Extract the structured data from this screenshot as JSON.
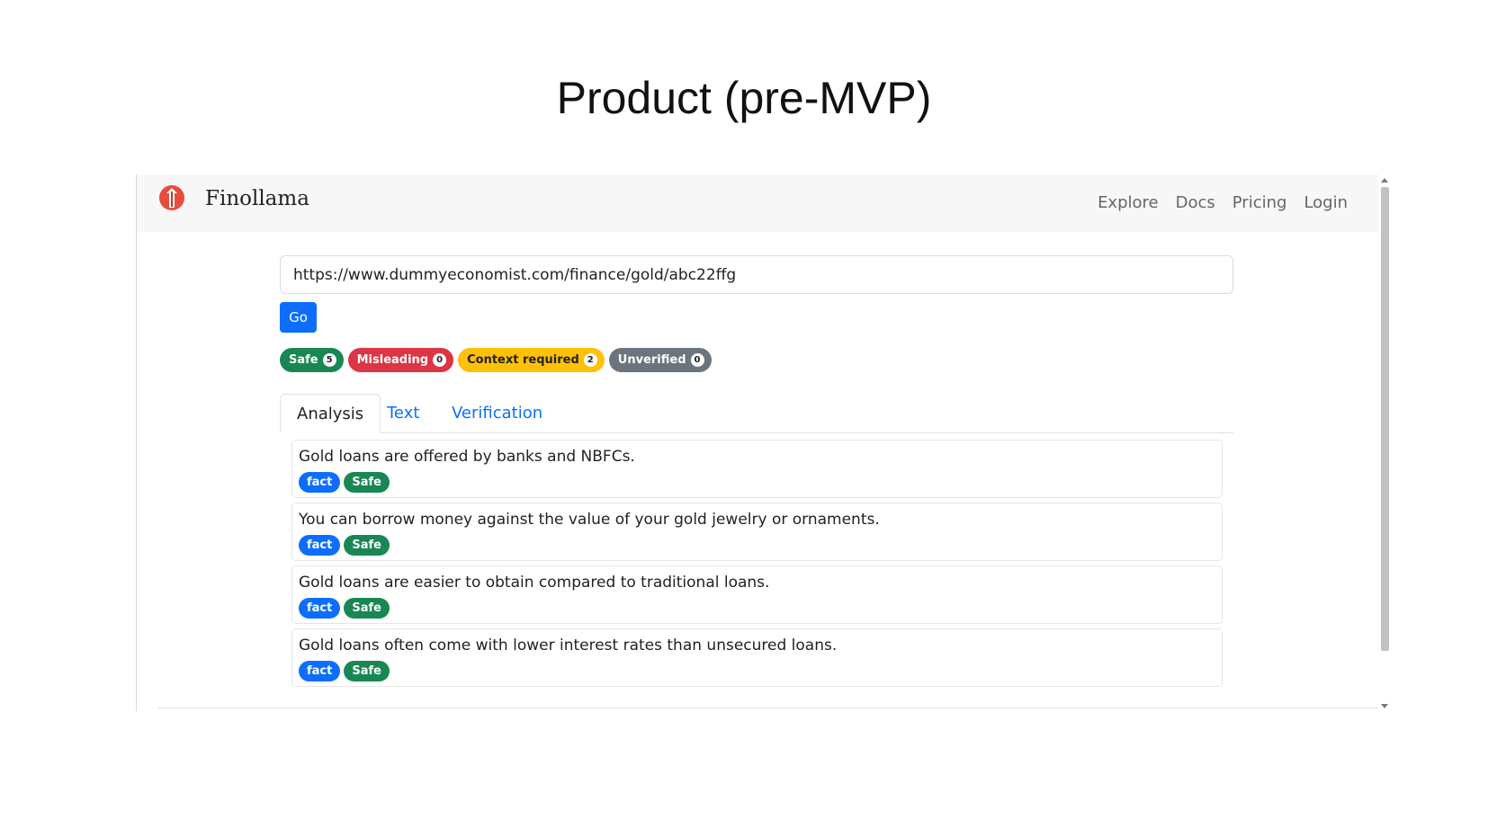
{
  "slide": {
    "title": "Product (pre-MVP)"
  },
  "app": {
    "brand": "Finollama",
    "logo_icon": "finollama-logo-icon"
  },
  "nav": {
    "items": [
      "Explore",
      "Docs",
      "Pricing",
      "Login"
    ]
  },
  "search": {
    "value": "https://www.dummyeconomist.com/finance/gold/abc22ffg",
    "go_label": "Go"
  },
  "summary_badges": [
    {
      "label": "Safe",
      "count": "5",
      "color": "#198754",
      "text_color": "#ffffff"
    },
    {
      "label": "Misleading",
      "count": "0",
      "color": "#dc3545",
      "text_color": "#ffffff"
    },
    {
      "label": "Context required",
      "count": "2",
      "color": "#ffc107",
      "text_color": "#222222"
    },
    {
      "label": "Unverified",
      "count": "0",
      "color": "#6c757d",
      "text_color": "#ffffff"
    }
  ],
  "tabs": [
    {
      "label": "Analysis",
      "active": true
    },
    {
      "label": "Text",
      "active": false
    },
    {
      "label": "Verification",
      "active": false
    }
  ],
  "claims": [
    {
      "text": "Gold loans are offered by banks and NBFCs.",
      "tags": [
        "fact",
        "Safe"
      ]
    },
    {
      "text": "You can borrow money against the value of your gold jewelry or ornaments.",
      "tags": [
        "fact",
        "Safe"
      ]
    },
    {
      "text": "Gold loans are easier to obtain compared to traditional loans.",
      "tags": [
        "fact",
        "Safe"
      ]
    },
    {
      "text": "Gold loans often come with lower interest rates than unsecured loans.",
      "tags": [
        "fact",
        "Safe"
      ]
    }
  ],
  "colors": {
    "primary": "#0d6efd",
    "safe": "#198754",
    "navbar_bg": "#f7f7f7",
    "logo": "#e74c3c"
  }
}
